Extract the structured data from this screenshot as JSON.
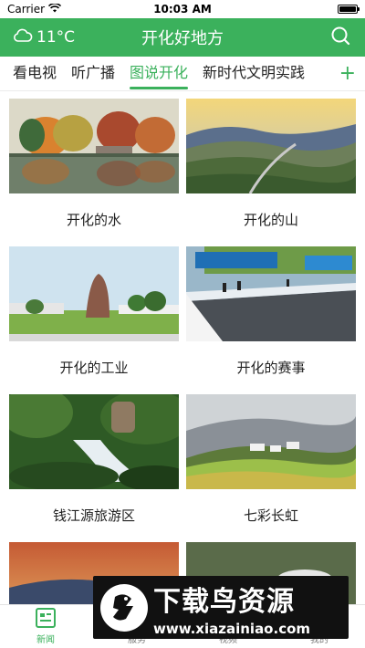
{
  "status_bar": {
    "carrier": "Carrier",
    "time": "10:03 AM"
  },
  "header": {
    "weather": "11°C",
    "title": "开化好地方"
  },
  "tabs": [
    {
      "label": "看电视",
      "active": false
    },
    {
      "label": "听广播",
      "active": false
    },
    {
      "label": "图说开化",
      "active": true
    },
    {
      "label": "新时代文明实践",
      "active": false
    }
  ],
  "tab_add": "+",
  "cards": [
    {
      "caption": "开化的水"
    },
    {
      "caption": "开化的山"
    },
    {
      "caption": "开化的工业"
    },
    {
      "caption": "开化的赛事"
    },
    {
      "caption": "钱江源旅游区"
    },
    {
      "caption": "七彩长虹"
    }
  ],
  "bottom_tabs": [
    {
      "label": "新闻",
      "active": true
    },
    {
      "label": "服务",
      "active": false
    },
    {
      "label": "视频",
      "active": false
    },
    {
      "label": "我的",
      "active": false
    }
  ],
  "watermark": {
    "title": "下载鸟资源",
    "url": "www.xiazainiao.com"
  },
  "colors": {
    "accent": "#3bb15c"
  }
}
